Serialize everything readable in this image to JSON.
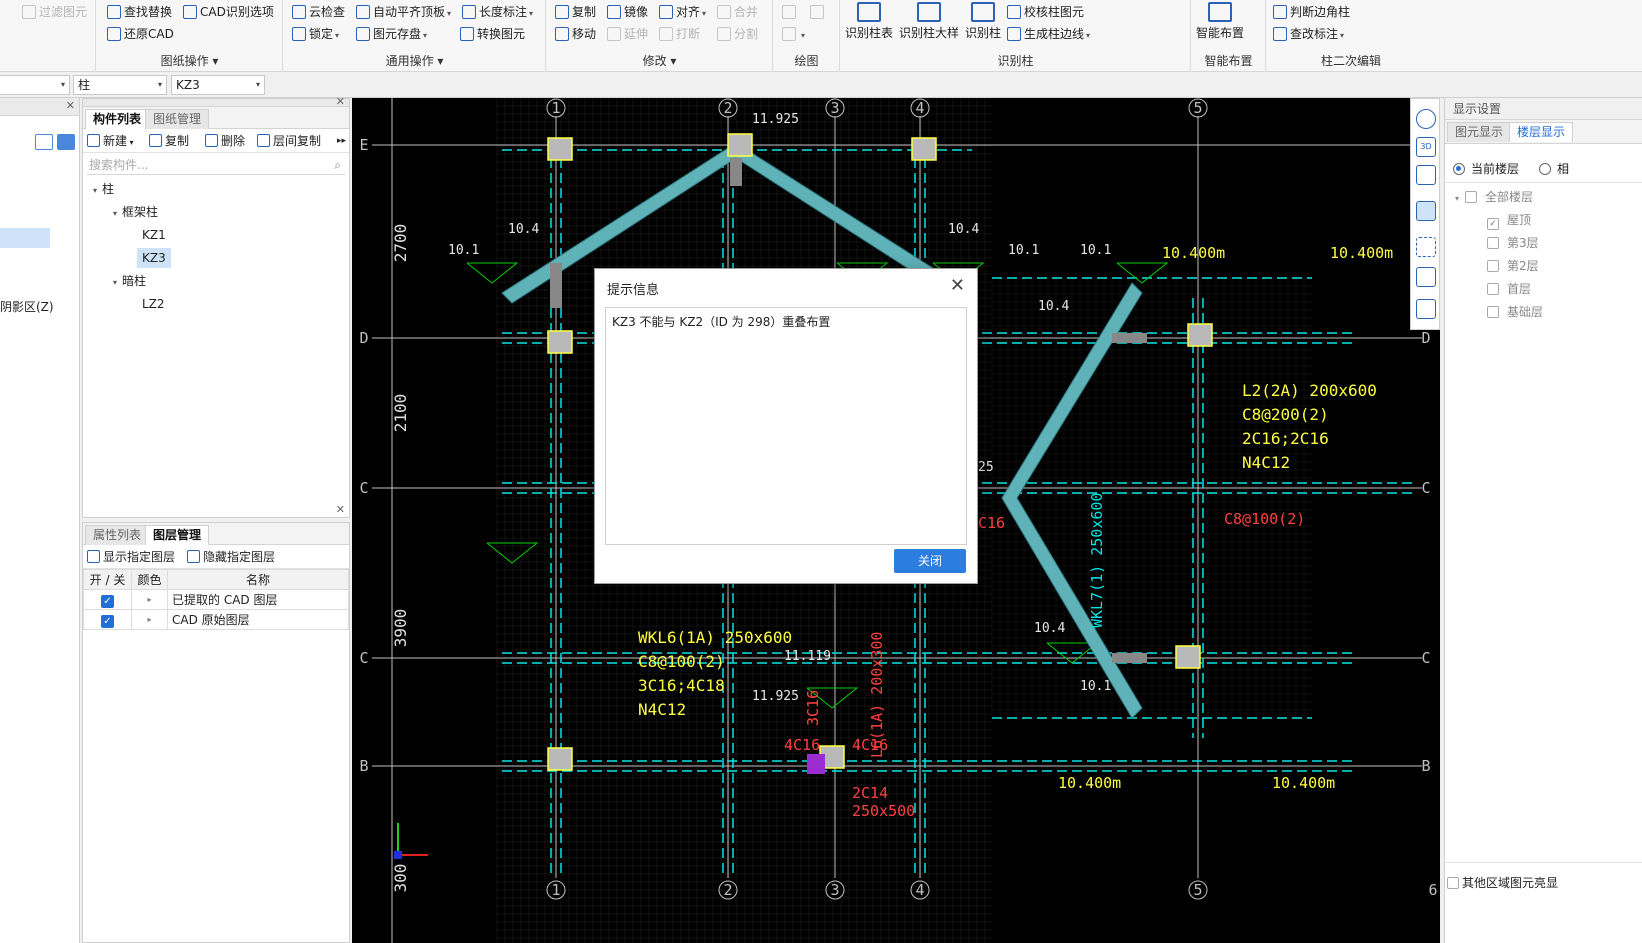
{
  "ribbon": {
    "filter": "过滤图元",
    "find_replace": "查找替换",
    "cad_options": "CAD识别选项",
    "restore_cad": "还原CAD",
    "group_drawing": "图纸操作",
    "cloud_check": "云检查",
    "auto_flush": "自动平齐顶板",
    "length_dim": "长度标注",
    "lock": "锁定",
    "store_elements": "图元存盘",
    "convert_elements": "转换图元",
    "group_general": "通用操作",
    "copy": "复制",
    "mirror": "镜像",
    "align": "对齐",
    "merge": "合并",
    "move": "移动",
    "extend": "延伸",
    "break": "打断",
    "split": "分割",
    "group_modify": "修改",
    "group_draw": "绘图",
    "id_col_table": "识别柱表",
    "id_col_detail": "识别柱大样",
    "id_col": "识别柱",
    "check_col": "校核柱图元",
    "gen_col_edge": "生成柱边线",
    "group_identify": "识别柱",
    "smart_layout": "智能布置",
    "group_smart": "智能布置",
    "judge_corner": "判断边角柱",
    "edit_label": "查改标注",
    "group_secondary": "柱二次编辑"
  },
  "selector": {
    "type_value": "柱",
    "name_value": "KZ3"
  },
  "left_stub": {
    "shadow_label": "阴影区(Z)"
  },
  "component_panel": {
    "tab_list": "构件列表",
    "tab_drawings": "图纸管理",
    "btn_new": "新建",
    "btn_copy": "复制",
    "btn_delete": "删除",
    "btn_floor_copy": "层间复制",
    "search_placeholder": "搜索构件...",
    "tree": {
      "root": "柱",
      "group1": "框架柱",
      "kz1": "KZ1",
      "kz3": "KZ3",
      "group2": "暗柱",
      "lz2": "LZ2"
    }
  },
  "layer_panel": {
    "tab_props": "属性列表",
    "tab_layers": "图层管理",
    "btn_show": "显示指定图层",
    "btn_hide": "隐藏指定图层",
    "col_onoff": "开 / 关",
    "col_color": "颜色",
    "col_name": "名称",
    "rows": [
      {
        "name": "已提取的 CAD 图层",
        "on": true
      },
      {
        "name": "CAD 原始图层",
        "on": true
      }
    ]
  },
  "right_panel": {
    "title": "显示设置",
    "tab_elements": "图元显示",
    "tab_floors": "楼层显示",
    "radio_current": "当前楼层",
    "radio_other": "相",
    "all_floors": "全部楼层",
    "floors": [
      "屋顶",
      "第3层",
      "第2层",
      "首层",
      "基础层"
    ],
    "other_region": "其他区域图元亮显"
  },
  "dialog": {
    "title": "提示信息",
    "message": "KZ3 不能与 KZ2（ID 为 298）重叠布置",
    "close_btn": "关闭"
  },
  "cad": {
    "axis_numbers": [
      "1",
      "2",
      "3",
      "4",
      "5",
      "6"
    ],
    "axis_letters": [
      "E",
      "D",
      "C",
      "C",
      "B"
    ],
    "dims": [
      "2700",
      "2100",
      "3900",
      "300"
    ],
    "elevations": [
      "11.925",
      "10.4",
      "10.1",
      "10.4",
      "10.1",
      "10.1",
      "10.4",
      "11.119",
      "11.925",
      "10.4",
      "10.1",
      "25"
    ],
    "beam_l2": [
      "L2(2A) 200x600",
      "C8@200(2)",
      "2C16;2C16",
      "N4C12"
    ],
    "beam_wkl6": [
      "WKL6(1A) 250x600",
      "C8@100(2)",
      "3C16;4C18",
      "N4C12"
    ],
    "misc": [
      "C8@100(2)",
      "C16",
      "3C16",
      "4C16",
      "4C16",
      "2C14",
      "250x500",
      "10.400m",
      "10.400m",
      "10.400m",
      "10.400m",
      "L6(1A) 200x300",
      "WKL7(1) 250x600"
    ],
    "colors": {
      "background": "#000000",
      "axis": "#c0c0c0",
      "beam": "#00e5e5",
      "rebar_text": "#ffff40",
      "red_text": "#ff4040",
      "green": "#00d000",
      "roof": "#5fb2b8"
    }
  }
}
